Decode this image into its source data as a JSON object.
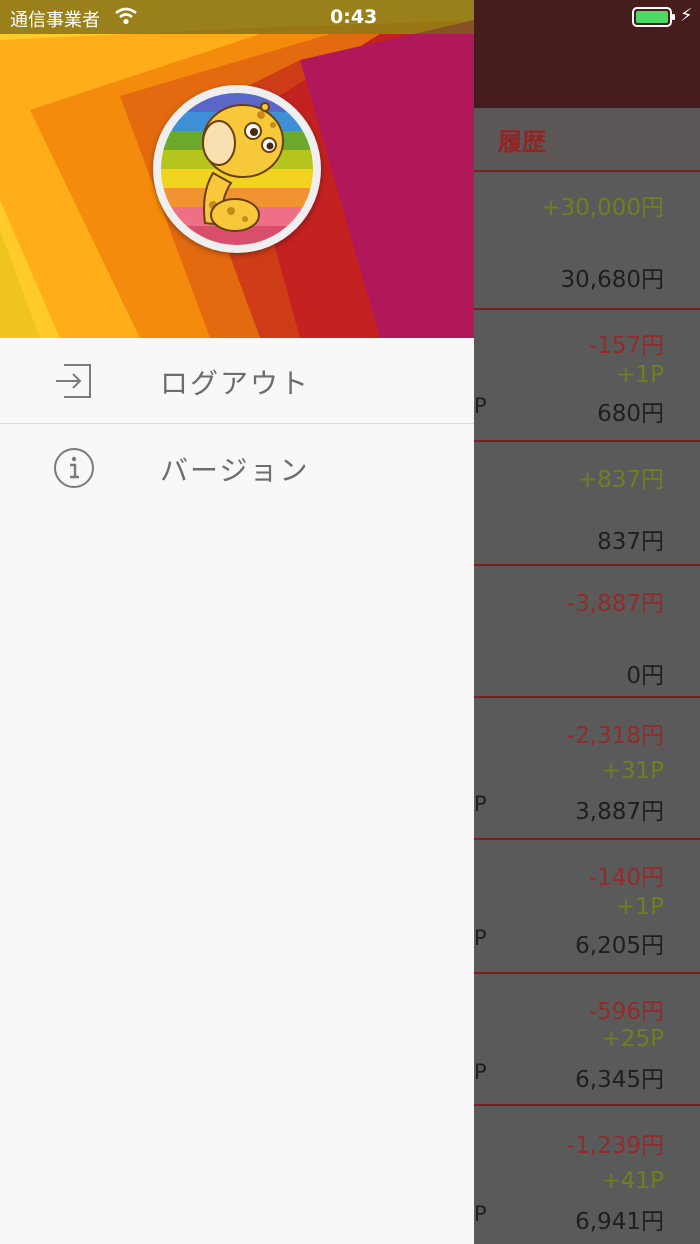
{
  "status_bar": {
    "carrier": "通信事業者",
    "time": "0:43"
  },
  "drawer": {
    "menu": [
      {
        "label": "ログアウト",
        "icon": "logout-icon"
      },
      {
        "label": "バージョン",
        "icon": "info-icon"
      }
    ]
  },
  "background_app": {
    "tab_label": "履歴",
    "rows": [
      {
        "amount": "+30,000円",
        "points": "",
        "balance": "30,680円"
      },
      {
        "amount": "-157円",
        "points": "+1P",
        "balance": "680円"
      },
      {
        "amount": "+837円",
        "points": "",
        "balance": "837円"
      },
      {
        "amount": "-3,887円",
        "points": "",
        "balance": "0円"
      },
      {
        "amount": "-2,318円",
        "points": "+31P",
        "balance": "3,887円"
      },
      {
        "amount": "-140円",
        "points": "+1P",
        "balance": "6,205円"
      },
      {
        "amount": "-596円",
        "points": "+25P",
        "balance": "6,345円"
      },
      {
        "amount": "-1,239円",
        "points": "+41P",
        "balance": "6,941円"
      }
    ]
  },
  "colors": {
    "accent": "#8f2626",
    "positive": "#6e7f22",
    "drawer_bg": "#f8f8f8"
  }
}
